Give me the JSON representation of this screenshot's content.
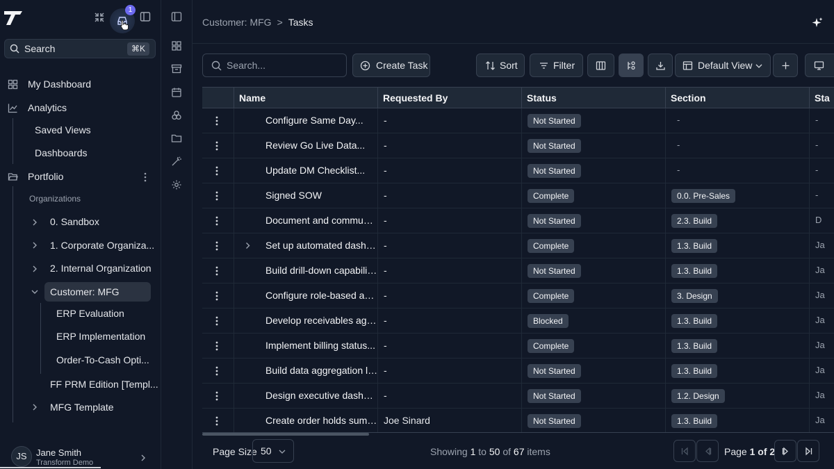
{
  "sidebar": {
    "search_label": "Search",
    "search_shortcut": "⌘K",
    "notification_count": "1",
    "nav": {
      "my_dashboard": "My Dashboard",
      "analytics": "Analytics",
      "saved_views": "Saved Views",
      "dashboards": "Dashboards",
      "portfolio": "Portfolio",
      "organizations_heading": "Organizations"
    },
    "orgs": [
      {
        "label": "0. Sandbox"
      },
      {
        "label": "1. Corporate Organiza..."
      },
      {
        "label": "2. Internal Organization"
      },
      {
        "label": "Customer: MFG"
      }
    ],
    "customer_children": [
      {
        "label": "ERP Evaluation"
      },
      {
        "label": "ERP Implementation"
      },
      {
        "label": "Order-To-Cash Opti..."
      }
    ],
    "ff_prm": "FF PRM Edition [Templ...",
    "mfg_template": "MFG Template",
    "user": {
      "initials": "JS",
      "name": "Jane Smith",
      "org": "Transform Demo"
    }
  },
  "breadcrumb": {
    "parent": "Customer: MFG",
    "separator": ">",
    "current": "Tasks"
  },
  "toolbar": {
    "search_placeholder": "Search...",
    "create_task": "Create Task",
    "sort": "Sort",
    "filter": "Filter",
    "view": "Default View"
  },
  "table": {
    "columns": [
      "Name",
      "Requested By",
      "Status",
      "Section",
      "Sta"
    ],
    "rows": [
      {
        "name": "Configure Same Day...",
        "requested_by": "-",
        "status": "Not Started",
        "section": "-",
        "extra": "-",
        "expandable": false
      },
      {
        "name": "Review Go Live Data...",
        "requested_by": "-",
        "status": "Not Started",
        "section": "-",
        "extra": "-",
        "expandable": false
      },
      {
        "name": "Update DM Checklist...",
        "requested_by": "-",
        "status": "Not Started",
        "section": "-",
        "extra": "-",
        "expandable": false
      },
      {
        "name": "Signed SOW",
        "requested_by": "-",
        "status": "Complete",
        "section": "0.0. Pre-Sales",
        "extra": "-",
        "expandable": false
      },
      {
        "name": "Document and communica...",
        "requested_by": "-",
        "status": "Not Started",
        "section": "2.3. Build",
        "extra": "D",
        "expandable": false
      },
      {
        "name": "Set up automated dashboa...",
        "requested_by": "-",
        "status": "Complete",
        "section": "1.3. Build",
        "extra": "Ja",
        "expandable": true
      },
      {
        "name": "Build drill-down capability...",
        "requested_by": "-",
        "status": "Not Started",
        "section": "1.3. Build",
        "extra": "Ja",
        "expandable": false
      },
      {
        "name": "Configure role-based acces...",
        "requested_by": "-",
        "status": "Complete",
        "section": "3. Design",
        "extra": "Ja",
        "expandable": false
      },
      {
        "name": "Develop receivables aging...",
        "requested_by": "-",
        "status": "Blocked",
        "section": "1.3. Build",
        "extra": "Ja",
        "expandable": false
      },
      {
        "name": "Implement billing status...",
        "requested_by": "-",
        "status": "Complete",
        "section": "1.3. Build",
        "extra": "Ja",
        "expandable": false
      },
      {
        "name": "Build data aggregation laye...",
        "requested_by": "-",
        "status": "Not Started",
        "section": "1.3. Build",
        "extra": "Ja",
        "expandable": false
      },
      {
        "name": "Design executive dashboar...",
        "requested_by": "-",
        "status": "Not Started",
        "section": "1.2. Design",
        "extra": "Ja",
        "expandable": false
      },
      {
        "name": "Create order holds summa...",
        "requested_by": "Joe Sinard",
        "status": "Not Started",
        "section": "1.3. Build",
        "extra": "Ja",
        "expandable": false
      }
    ]
  },
  "footer": {
    "page_size_label": "Page Size",
    "page_size_value": "50",
    "showing_prefix": "Showing",
    "range_start": "1",
    "to": "to",
    "range_end": "50",
    "of": "of",
    "total": "67",
    "items": "items",
    "page_label": "Page",
    "page_current": "1 of 2"
  }
}
